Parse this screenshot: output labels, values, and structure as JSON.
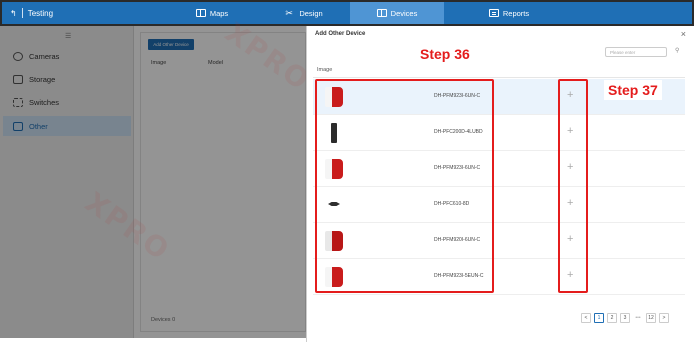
{
  "topbar": {
    "app_name": "Testing",
    "tabs": [
      {
        "label": "Maps",
        "icon": "map-icon"
      },
      {
        "label": "Design",
        "icon": "tools-icon"
      },
      {
        "label": "Devices",
        "icon": "devices-icon",
        "active": true
      },
      {
        "label": "Reports",
        "icon": "report-icon"
      }
    ],
    "colors": {
      "bar": "#1f6fb5",
      "active_tab": "#4f95d4"
    }
  },
  "sidebar": {
    "items": [
      {
        "label": "Cameras",
        "icon": "camera-icon"
      },
      {
        "label": "Storage",
        "icon": "storage-icon"
      },
      {
        "label": "Switches",
        "icon": "switch-icon"
      },
      {
        "label": "Other",
        "icon": "other-device-icon",
        "active": true
      }
    ]
  },
  "background_panel": {
    "add_button": "Add Other Device",
    "columns": [
      "Image",
      "Model"
    ],
    "footer": "Devices 0"
  },
  "modal": {
    "title": "Add Other Device",
    "search_placeholder": "Please enter",
    "column_image": "Image",
    "rows": [
      {
        "model": "DH-PFM923I-6UN-C",
        "image": "red-enclosure",
        "selected": true
      },
      {
        "model": "DH-PFC200D-4LUBD",
        "image": "bullet"
      },
      {
        "model": "DH-PFM923I-6UN-C",
        "image": "red-enclosure"
      },
      {
        "model": "DH-PFC610-8D",
        "image": "flat"
      },
      {
        "model": "DH-PFM920I-6UN-C",
        "image": "red-enclosure"
      },
      {
        "model": "DH-PFM923I-5EUN-C",
        "image": "red-enclosure"
      }
    ],
    "add_symbol": "+",
    "pagination": {
      "prev": "<",
      "pages": [
        "1",
        "2",
        "3"
      ],
      "ellipsis": "•••",
      "last": "12",
      "next": ">",
      "current": "1"
    }
  },
  "annotations": {
    "step36": "Step 36",
    "step37": "Step 37",
    "color": "#e41c1c"
  },
  "watermark": "XPRO"
}
